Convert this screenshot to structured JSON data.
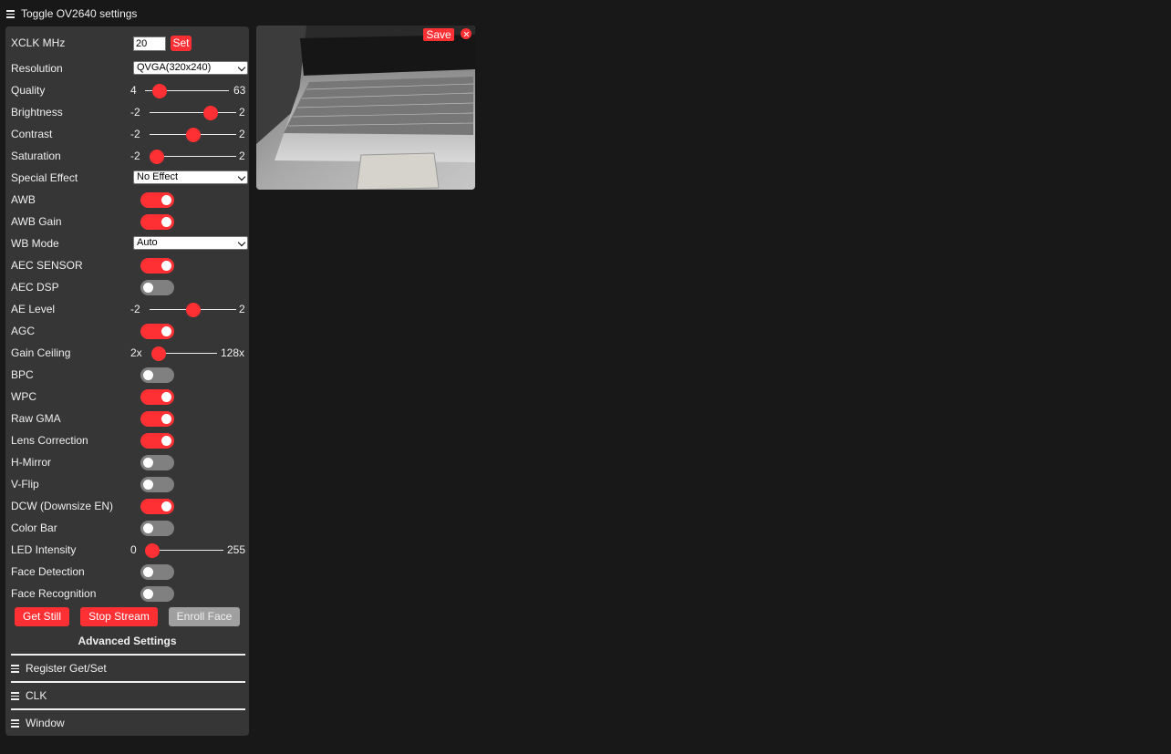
{
  "header": {
    "toggle_label": "Toggle OV2640 settings"
  },
  "settings": {
    "xclk": {
      "label": "XCLK MHz",
      "value": "20",
      "set_label": "Set"
    },
    "resolution": {
      "label": "Resolution",
      "selected": "QVGA(320x240)"
    },
    "quality": {
      "label": "Quality",
      "min": "4",
      "max": "63",
      "value": 10
    },
    "brightness": {
      "label": "Brightness",
      "min": "-2",
      "max": "2",
      "value": 1
    },
    "contrast": {
      "label": "Contrast",
      "min": "-2",
      "max": "2",
      "value": 0
    },
    "saturation": {
      "label": "Saturation",
      "min": "-2",
      "max": "2",
      "value": -2
    },
    "special_effect": {
      "label": "Special Effect",
      "selected": "No Effect"
    },
    "awb": {
      "label": "AWB",
      "on": true
    },
    "awb_gain": {
      "label": "AWB Gain",
      "on": true
    },
    "wb_mode": {
      "label": "WB Mode",
      "selected": "Auto"
    },
    "aec_sensor": {
      "label": "AEC SENSOR",
      "on": true
    },
    "aec_dsp": {
      "label": "AEC DSP",
      "on": false
    },
    "ae_level": {
      "label": "AE Level",
      "min": "-2",
      "max": "2",
      "value": 0
    },
    "agc": {
      "label": "AGC",
      "on": true
    },
    "gain_ceiling": {
      "label": "Gain Ceiling",
      "min": "2x",
      "max": "128x",
      "value": 0
    },
    "bpc": {
      "label": "BPC",
      "on": false
    },
    "wpc": {
      "label": "WPC",
      "on": true
    },
    "raw_gma": {
      "label": "Raw GMA",
      "on": true
    },
    "lens_correction": {
      "label": "Lens Correction",
      "on": true
    },
    "h_mirror": {
      "label": "H-Mirror",
      "on": false
    },
    "v_flip": {
      "label": "V-Flip",
      "on": false
    },
    "dcw": {
      "label": "DCW (Downsize EN)",
      "on": true
    },
    "color_bar": {
      "label": "Color Bar",
      "on": false
    },
    "led_intensity": {
      "label": "LED Intensity",
      "min": "0",
      "max": "255",
      "value": 0
    },
    "face_detection": {
      "label": "Face Detection",
      "on": false
    },
    "face_recognition": {
      "label": "Face Recognition",
      "on": false
    }
  },
  "buttons": {
    "get_still": "Get Still",
    "stop_stream": "Stop Stream",
    "enroll_face": "Enroll Face"
  },
  "advanced": {
    "title": "Advanced Settings",
    "sections": [
      "Register Get/Set",
      "CLK",
      "Window"
    ]
  },
  "stream": {
    "save_label": "Save"
  },
  "colors": {
    "accent": "#ff3034",
    "panel": "#363636",
    "background": "#181818",
    "off": "#808080"
  }
}
